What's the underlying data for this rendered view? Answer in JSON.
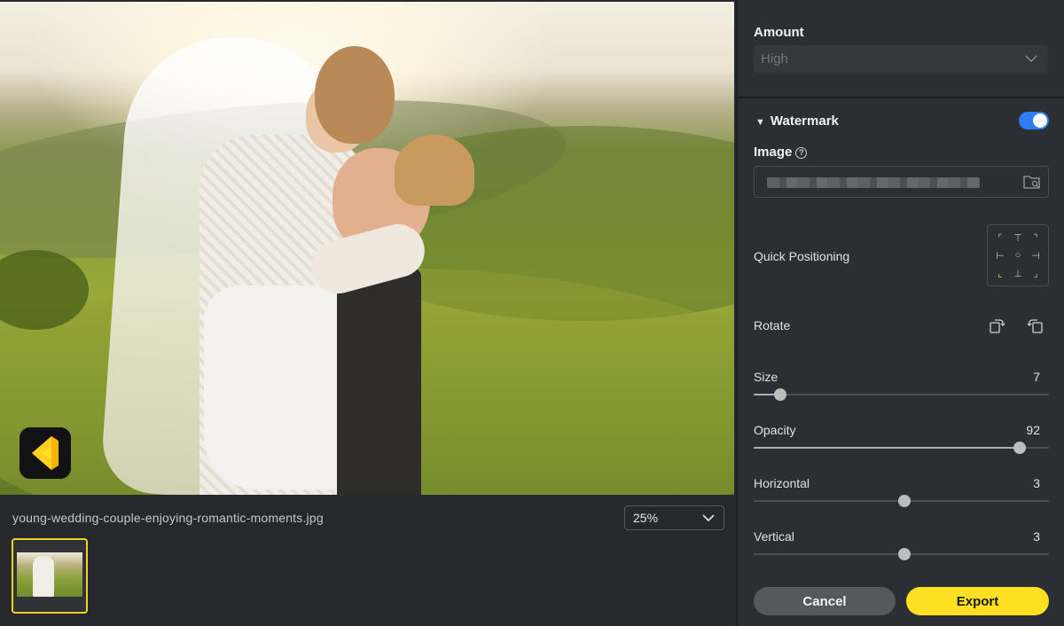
{
  "canvas": {
    "filename": "young-wedding-couple-enjoying-romantic-moments.jpg",
    "zoom_value": "25%",
    "zoom_icon": "chevron-down-icon",
    "thumbnail_selected": true,
    "accent": "#f5d320"
  },
  "panel": {
    "amount": {
      "label": "Amount",
      "value": "High"
    },
    "watermark": {
      "title": "Watermark",
      "enabled": true,
      "toggle_color": "#2f7df6"
    },
    "image": {
      "label": "Image",
      "help_glyph": "?"
    },
    "quick_positioning": {
      "label": "Quick Positioning",
      "cells": [
        "⌜",
        "⊤",
        "⌝",
        "⊢",
        "○",
        "⊣",
        "⌞",
        "⊥",
        "⌟"
      ],
      "active_index": 6
    },
    "rotate": {
      "label": "Rotate",
      "left_icon": "rotate-left-icon",
      "right_icon": "rotate-right-icon"
    },
    "sliders": [
      {
        "key": "size",
        "label": "Size",
        "value": "7",
        "fraction": 0.09
      },
      {
        "key": "opacity",
        "label": "Opacity",
        "value": "92",
        "fraction": 0.9
      },
      {
        "key": "horizontal",
        "label": "Horizontal",
        "value": "3",
        "fraction": 0.51
      },
      {
        "key": "vertical",
        "label": "Vertical",
        "value": "3",
        "fraction": 0.51
      }
    ],
    "buttons": {
      "cancel": "Cancel",
      "export": "Export",
      "export_color": "#fde021"
    }
  }
}
